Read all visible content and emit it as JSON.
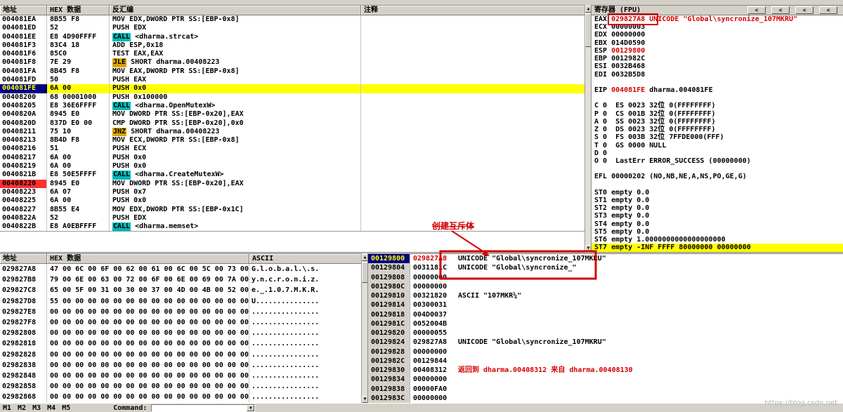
{
  "colors": {
    "accent_red": "#d40000",
    "highlight_yellow": "#ffff00",
    "call_highlight": "#00b6b6",
    "jump_highlight": "#d8a400",
    "selection_navy": "#000080",
    "breakpoint_red": "#ff3030"
  },
  "disasm": {
    "headers": [
      "地址",
      "HEX 数据",
      "反汇编",
      "注释"
    ],
    "rows": [
      {
        "addr": "004081EA",
        "hex": "8B55 F8",
        "asm": "MOV EDX,DWORD PTR SS:[EBP-0x8]"
      },
      {
        "addr": "004081ED",
        "hex": "52",
        "asm": "PUSH EDX"
      },
      {
        "addr": "004081EE",
        "hex": "E8 4D90FFFF",
        "op": "CALL",
        "opstyle": "call",
        "asm": " <dharma.strcat>"
      },
      {
        "addr": "004081F3",
        "hex": "83C4 18",
        "asm": "ADD ESP,0x18"
      },
      {
        "addr": "004081F6",
        "hex": "85C0",
        "asm": "TEST EAX,EAX"
      },
      {
        "addr": "004081F8",
        "hex": "7E 29",
        "op": "JLE",
        "opstyle": "jump",
        "asm": " SHORT dharma.00408223"
      },
      {
        "addr": "004081FA",
        "hex": "8B45 F8",
        "asm": "MOV EAX,DWORD PTR SS:[EBP-0x8]"
      },
      {
        "addr": "004081FD",
        "hex": "50",
        "asm": "PUSH EAX"
      },
      {
        "addr": "004081FE",
        "hex": "6A 00",
        "asm": "PUSH 0x0",
        "rowstyle": "current"
      },
      {
        "addr": "00408200",
        "hex": "68 00001000",
        "asm": "PUSH 0x100000"
      },
      {
        "addr": "00408205",
        "hex": "E8 36E6FFFF",
        "op": "CALL",
        "opstyle": "call",
        "asm": " <dharma.OpenMutexW>"
      },
      {
        "addr": "0040820A",
        "hex": "8945 E0",
        "asm": "MOV DWORD PTR SS:[EBP-0x20],EAX"
      },
      {
        "addr": "0040820D",
        "hex": "837D E0 00",
        "asm": "CMP DWORD PTR SS:[EBP-0x20],0x0"
      },
      {
        "addr": "00408211",
        "hex": "75 10",
        "op": "JNZ",
        "opstyle": "jump",
        "asm": " SHORT dharma.00408223"
      },
      {
        "addr": "00408213",
        "hex": "8B4D F8",
        "asm": "MOV ECX,DWORD PTR SS:[EBP-0x8]"
      },
      {
        "addr": "00408216",
        "hex": "51",
        "asm": "PUSH ECX"
      },
      {
        "addr": "00408217",
        "hex": "6A 00",
        "asm": "PUSH 0x0"
      },
      {
        "addr": "00408219",
        "hex": "6A 00",
        "asm": "PUSH 0x0"
      },
      {
        "addr": "0040821B",
        "hex": "E8 50E5FFFF",
        "op": "CALL",
        "opstyle": "call",
        "asm": " <dharma.CreateMutexW>"
      },
      {
        "addr": "00408220",
        "hex": "8945 E0",
        "asm": "MOV DWORD PTR SS:[EBP-0x20],EAX",
        "rowstyle": "breakpoint"
      },
      {
        "addr": "00408223",
        "hex": "6A 07",
        "asm": "PUSH 0x7"
      },
      {
        "addr": "00408225",
        "hex": "6A 00",
        "asm": "PUSH 0x0"
      },
      {
        "addr": "00408227",
        "hex": "8B55 E4",
        "asm": "MOV EDX,DWORD PTR SS:[EBP-0x1C]"
      },
      {
        "addr": "0040822A",
        "hex": "52",
        "asm": "PUSH EDX"
      },
      {
        "addr": "0040822B",
        "hex": "E8 A0EBFFFF",
        "op": "CALL",
        "opstyle": "call",
        "asm": " <dharma.memset>"
      }
    ]
  },
  "annotation": {
    "label": "创建互斥体"
  },
  "registers": {
    "title": "寄存器 (FPU)",
    "buttons": [
      "<",
      "<",
      "<",
      "<"
    ],
    "lines": [
      {
        "segs": [
          [
            "EAX ",
            "k"
          ],
          [
            "029827A8",
            "r"
          ],
          [
            " UNICODE \"Global\\syncronize_107MKRU\"",
            "r"
          ]
        ]
      },
      {
        "segs": [
          [
            "ECX 00000003",
            "k"
          ]
        ]
      },
      {
        "segs": [
          [
            "EDX 00000000",
            "k"
          ]
        ]
      },
      {
        "segs": [
          [
            "EBX 014D0590",
            "k"
          ]
        ]
      },
      {
        "segs": [
          [
            "ESP ",
            "k"
          ],
          [
            "00129800",
            "r"
          ]
        ]
      },
      {
        "segs": [
          [
            "EBP 0012982C",
            "k"
          ]
        ]
      },
      {
        "segs": [
          [
            "ESI 0032B468",
            "k"
          ]
        ]
      },
      {
        "segs": [
          [
            "EDI 0032B5D8",
            "k"
          ]
        ]
      },
      {
        "segs": []
      },
      {
        "segs": [
          [
            "EIP ",
            "k"
          ],
          [
            "004081FE",
            "r"
          ],
          [
            " dharma.004081FE",
            "k"
          ]
        ]
      },
      {
        "segs": []
      },
      {
        "segs": [
          [
            "C 0  ES 0023 32位 0(FFFFFFFF)",
            "k"
          ]
        ]
      },
      {
        "segs": [
          [
            "P 0  CS 001B 32位 0(FFFFFFFF)",
            "k"
          ]
        ]
      },
      {
        "segs": [
          [
            "A 0  SS 0023 32位 0(FFFFFFFF)",
            "k"
          ]
        ]
      },
      {
        "segs": [
          [
            "Z 0  DS 0023 32位 0(FFFFFFFF)",
            "k"
          ]
        ]
      },
      {
        "segs": [
          [
            "S 0  FS 003B 32位 7FFDE000(FFF)",
            "k"
          ]
        ]
      },
      {
        "segs": [
          [
            "T 0  GS 0000 NULL",
            "k"
          ]
        ]
      },
      {
        "segs": [
          [
            "D 0",
            "k"
          ]
        ]
      },
      {
        "segs": [
          [
            "O 0  LastErr ERROR_SUCCESS (00000000)",
            "k"
          ]
        ]
      },
      {
        "segs": []
      },
      {
        "segs": [
          [
            "EFL 00000202 (NO,NB,NE,A,NS,PO,GE,G)",
            "k"
          ]
        ]
      },
      {
        "segs": []
      },
      {
        "segs": [
          [
            "ST0 empty 0.0",
            "k"
          ]
        ]
      },
      {
        "segs": [
          [
            "ST1 empty 0.0",
            "k"
          ]
        ]
      },
      {
        "segs": [
          [
            "ST2 empty 0.0",
            "k"
          ]
        ]
      },
      {
        "segs": [
          [
            "ST3 empty 0.0",
            "k"
          ]
        ]
      },
      {
        "segs": [
          [
            "ST4 empty 0.0",
            "k"
          ]
        ]
      },
      {
        "segs": [
          [
            "ST5 empty 0.0",
            "k"
          ]
        ]
      },
      {
        "segs": [
          [
            "ST6 empty 1.0000000000000000000",
            "k"
          ]
        ]
      },
      {
        "segs": [
          [
            "ST7 empty -INF FFFF 80000000 00000000",
            "k"
          ]
        ],
        "hl": true
      }
    ]
  },
  "dump": {
    "headers": [
      "地址",
      "HEX 数据",
      "ASCII"
    ],
    "rows": [
      {
        "addr": "029827A8",
        "hex": "47 00 6C 00 6F 00 62 00 61 00 6C 00 5C 00 73 00",
        "ascii": "G.l.o.b.a.l.\\.s."
      },
      {
        "addr": "029827B8",
        "hex": "79 00 6E 00 63 00 72 00 6F 00 6E 00 69 00 7A 00",
        "ascii": "y.n.c.r.o.n.i.z."
      },
      {
        "addr": "029827C8",
        "hex": "65 00 5F 00 31 00 30 00 37 00 4D 00 4B 00 52 00",
        "ascii": "e._.1.0.7.M.K.R."
      },
      {
        "addr": "029827D8",
        "hex": "55 00 00 00 00 00 00 00 00 00 00 00 00 00 00 00",
        "ascii": "U..............."
      },
      {
        "addr": "029827E8",
        "hex": "00 00 00 00 00 00 00 00 00 00 00 00 00 00 00 00",
        "ascii": "................"
      },
      {
        "addr": "029827F8",
        "hex": "00 00 00 00 00 00 00 00 00 00 00 00 00 00 00 00",
        "ascii": "................"
      },
      {
        "addr": "02982808",
        "hex": "00 00 00 00 00 00 00 00 00 00 00 00 00 00 00 00",
        "ascii": "................"
      },
      {
        "addr": "02982818",
        "hex": "00 00 00 00 00 00 00 00 00 00 00 00 00 00 00 00",
        "ascii": "................"
      },
      {
        "addr": "02982828",
        "hex": "00 00 00 00 00 00 00 00 00 00 00 00 00 00 00 00",
        "ascii": "................"
      },
      {
        "addr": "02982838",
        "hex": "00 00 00 00 00 00 00 00 00 00 00 00 00 00 00 00",
        "ascii": "................"
      },
      {
        "addr": "02982848",
        "hex": "00 00 00 00 00 00 00 00 00 00 00 00 00 00 00 00",
        "ascii": "................"
      },
      {
        "addr": "02982858",
        "hex": "00 00 00 00 00 00 00 00 00 00 00 00 00 00 00 00",
        "ascii": "................"
      },
      {
        "addr": "02982868",
        "hex": "00 00 00 00 00 00 00 00 00 00 00 00 00 00 00 00",
        "ascii": "................"
      }
    ]
  },
  "stack": {
    "rows": [
      {
        "addr": "00129800",
        "value": "029827A8",
        "comment": "UNICODE \"Global\\syncronize_107MKRU\"",
        "sel": true,
        "vred": true
      },
      {
        "addr": "00129804",
        "value": "0031181C",
        "comment": "UNICODE \"Global\\syncronize_\""
      },
      {
        "addr": "00129808",
        "value": "00000000",
        "comment": ""
      },
      {
        "addr": "0012980C",
        "value": "00000000",
        "comment": ""
      },
      {
        "addr": "00129810",
        "value": "00321820",
        "comment": "ASCII \"107MKR¼\""
      },
      {
        "addr": "00129814",
        "value": "00300031",
        "comment": ""
      },
      {
        "addr": "00129818",
        "value": "004D0037",
        "comment": ""
      },
      {
        "addr": "0012981C",
        "value": "0052004B",
        "comment": ""
      },
      {
        "addr": "00129820",
        "value": "00000055",
        "comment": ""
      },
      {
        "addr": "00129824",
        "value": "029827A8",
        "comment": "UNICODE \"Global\\syncronize_107MKRU\""
      },
      {
        "addr": "00129828",
        "value": "00000000",
        "comment": ""
      },
      {
        "addr": "0012982C",
        "value": "00129844",
        "comment": ""
      },
      {
        "addr": "00129830",
        "value": "00408312",
        "comment": "返回到 dharma.00408312 来自 dharma.00408130",
        "cred": true
      },
      {
        "addr": "00129834",
        "value": "00000000",
        "comment": ""
      },
      {
        "addr": "00129838",
        "value": "00000FA0",
        "comment": ""
      },
      {
        "addr": "0012983C",
        "value": "00000000",
        "comment": ""
      }
    ]
  },
  "bottom": {
    "tabs": [
      "M1",
      "M2",
      "M3",
      "M4",
      "M5"
    ],
    "command_label": "Command:",
    "command_value": ""
  },
  "watermark": "https://blog.csdn.net"
}
